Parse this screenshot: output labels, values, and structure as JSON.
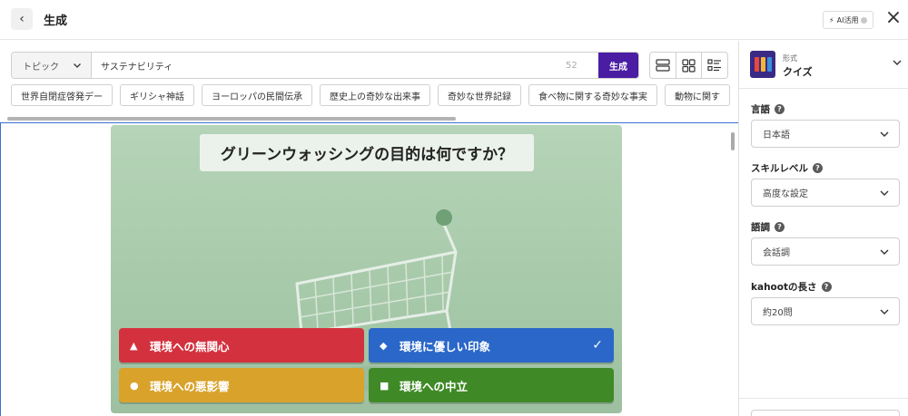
{
  "header": {
    "title": "生成",
    "ai_badge": "AI活用",
    "back_icon": "chevron-left-icon",
    "close_icon": "close-icon"
  },
  "search": {
    "topic_label": "トピック",
    "value": "サステナビリティ",
    "char_count": "52",
    "generate_label": "生成"
  },
  "chips": [
    "世界自閉症啓発デー",
    "ギリシャ神話",
    "ヨーロッパの民間伝承",
    "歴史上の奇妙な出来事",
    "奇妙な世界記録",
    "食べ物に関する奇妙な事実",
    "動物に関す"
  ],
  "slide": {
    "question": "グリーンウォッシングの目的は何ですか？",
    "answers": [
      {
        "shape": "▲",
        "text": "環境への無関心",
        "color": "#d4313e",
        "correct": false
      },
      {
        "shape": "◆",
        "text": "環境に優しい印象",
        "color": "#2a67c9",
        "correct": true,
        "check": "✓"
      },
      {
        "shape": "●",
        "text": "環境への悪影響",
        "color": "#d9a22b",
        "correct": false
      },
      {
        "shape": "■",
        "text": "環境への中立",
        "color": "#3f8a26",
        "correct": false
      }
    ]
  },
  "sidebar": {
    "format_label": "形式",
    "format_value": "クイズ",
    "fields": [
      {
        "label": "言語",
        "value": "日本語"
      },
      {
        "label": "スキルレベル",
        "value": "高度な設定"
      },
      {
        "label": "語調",
        "value": "会話調"
      },
      {
        "label": "kahootの長さ",
        "value": "約20問"
      }
    ]
  },
  "colors": {
    "accent": "#4b1da3",
    "selection_border": "#3b6fd0"
  }
}
